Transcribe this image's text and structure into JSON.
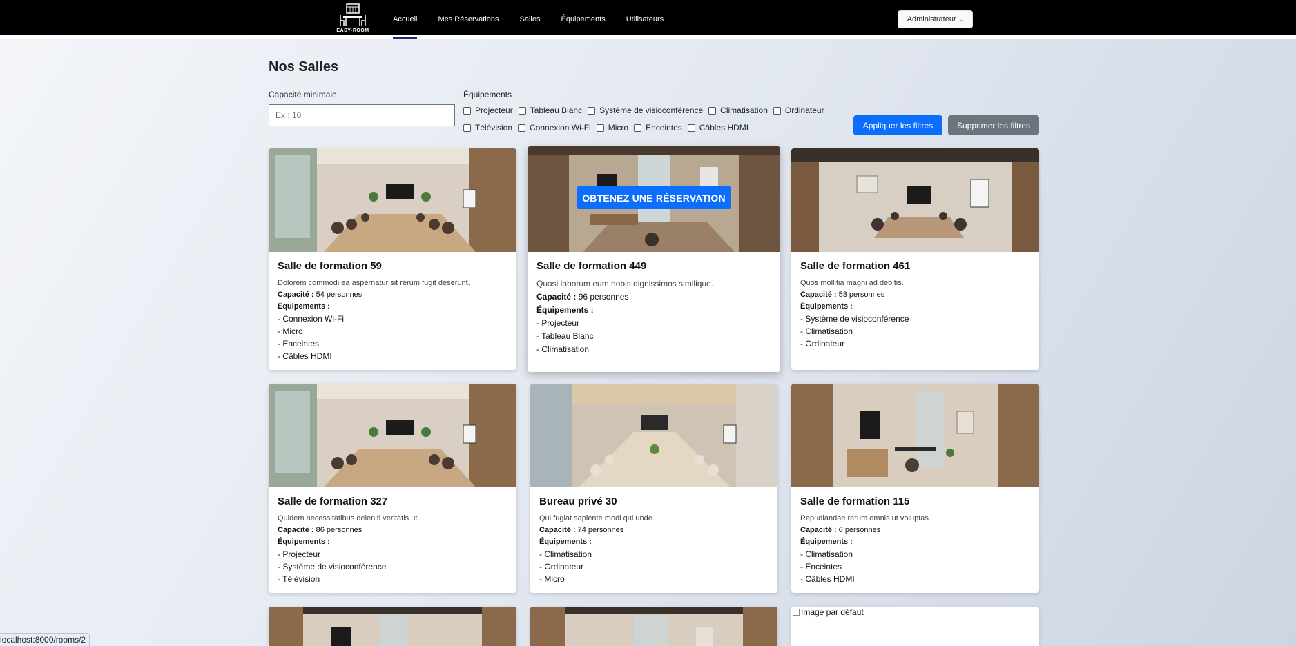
{
  "nav": {
    "logo_text": "EASY-ROOM",
    "links": [
      {
        "label": "Accueil"
      },
      {
        "label": "Mes Réservations"
      },
      {
        "label": "Salles"
      },
      {
        "label": "Équipements"
      },
      {
        "label": "Utilisateurs"
      }
    ],
    "active": "Accueil",
    "admin_label": "Administrateur"
  },
  "page": {
    "title": "Nos Salles"
  },
  "filters": {
    "capacity_label": "Capacité minimale",
    "capacity_placeholder": "Ex : 10",
    "equipment_label": "Équipements",
    "equipment": [
      "Projecteur",
      "Tableau Blanc",
      "Système de visioconférence",
      "Climatisation",
      "Ordinateur",
      "Télévision",
      "Connexion Wi-Fi",
      "Micro",
      "Enceintes",
      "Câbles HDMI"
    ],
    "apply_label": "Appliquer les filtres",
    "clear_label": "Supprimer les filtres"
  },
  "labels": {
    "capacity": "Capacité :",
    "equipments": "Équipements :",
    "reserve": "OBTENEZ UNE RÉSERVATION",
    "default_image_alt": "Image par défaut"
  },
  "rooms": [
    {
      "name": "Salle de formation 59",
      "description": "Dolorem commodi ea aspernatur sit rerum fugit deserunt.",
      "capacity": "54 personnes",
      "equipment": [
        "- Connexion Wi-Fi",
        "- Micro",
        "- Enceintes",
        "- Câbles HDMI"
      ]
    },
    {
      "name": "Salle de formation 449",
      "description": "Quasi laborum eum nobis dignissimos similique.",
      "capacity": "96 personnes",
      "equipment": [
        "- Projecteur",
        "- Tableau Blanc",
        "- Climatisation"
      ]
    },
    {
      "name": "Salle de formation 461",
      "description": "Quos mollitia magni ad debitis.",
      "capacity": "53 personnes",
      "equipment": [
        "- Système de visioconférence",
        "- Climatisation",
        "- Ordinateur"
      ]
    },
    {
      "name": "Salle de formation 327",
      "description": "Quidem necessitatibus deleniti veritatis ut.",
      "capacity": "86 personnes",
      "equipment": [
        "- Projecteur",
        "- Système de visioconférence",
        "- Télévision"
      ]
    },
    {
      "name": "Bureau privé 30",
      "description": "Qui fugiat sapiente modi qui unde.",
      "capacity": "74 personnes",
      "equipment": [
        "- Climatisation",
        "- Ordinateur",
        "- Micro"
      ]
    },
    {
      "name": "Salle de formation 115",
      "description": "Repudiandae rerum omnis ut voluptas.",
      "capacity": "6 personnes",
      "equipment": [
        "- Climatisation",
        "- Enceintes",
        "- Câbles HDMI"
      ]
    }
  ],
  "status_bar": {
    "url": "localhost:8000/rooms/2"
  }
}
